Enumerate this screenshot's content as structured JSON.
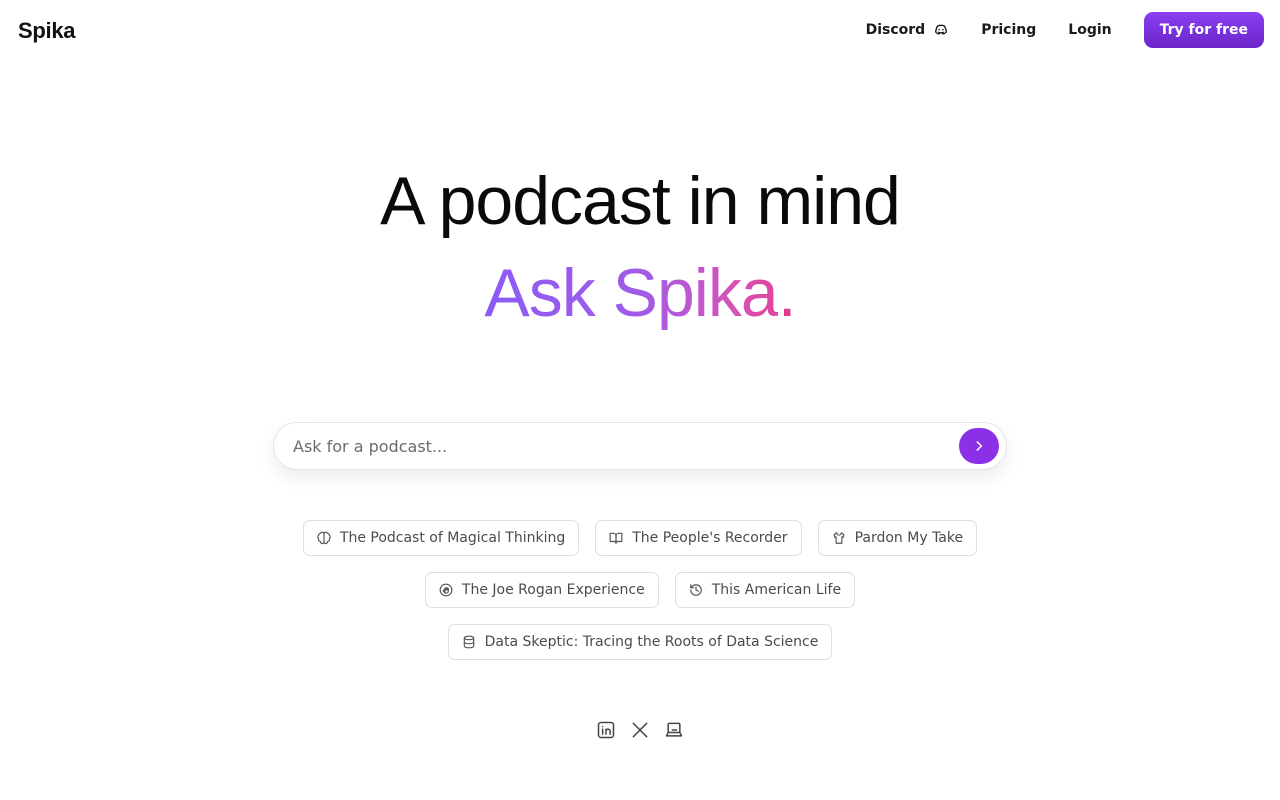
{
  "header": {
    "logo": "Spika",
    "nav": {
      "discord_label": "Discord",
      "pricing_label": "Pricing",
      "login_label": "Login",
      "cta_label": "Try for free"
    }
  },
  "hero": {
    "title": "A podcast in mind",
    "subtitle": "Ask Spika",
    "subtitle_dot": "."
  },
  "search": {
    "placeholder": "Ask for a podcast...",
    "value": ""
  },
  "suggestions": [
    [
      {
        "label": "The Podcast of Magical Thinking",
        "icon": "brain-icon"
      },
      {
        "label": "The People's Recorder",
        "icon": "book-open-icon"
      },
      {
        "label": "Pardon My Take",
        "icon": "shirt-icon"
      }
    ],
    [
      {
        "label": "The Joe Rogan Experience",
        "icon": "hand-icon"
      },
      {
        "label": "This American Life",
        "icon": "history-icon"
      }
    ],
    [
      {
        "label": "Data Skeptic: Tracing the Roots of Data Science",
        "icon": "database-icon"
      }
    ]
  ],
  "socials": [
    "linkedin-icon",
    "x-icon",
    "laptop-icon"
  ],
  "colors": {
    "accent": "#8b30e6",
    "cta_top": "#8a3ff2",
    "cta_bottom": "#6b25c9",
    "gradient_start": "#8b5cf6",
    "gradient_end": "#e0459a"
  }
}
